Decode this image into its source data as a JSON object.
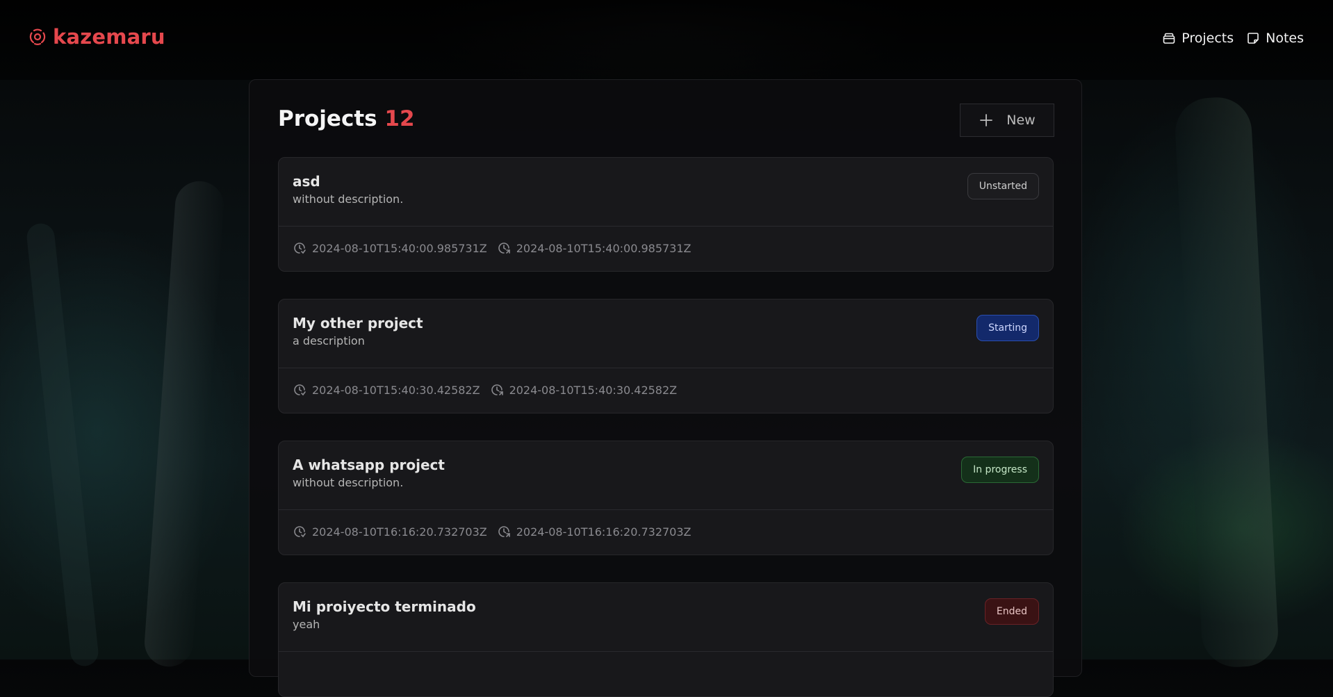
{
  "header": {
    "brand": "kazemaru",
    "nav": [
      {
        "label": "Projects",
        "icon": "archive-icon"
      },
      {
        "label": "Notes",
        "icon": "sticky-note-icon"
      }
    ]
  },
  "panel": {
    "title": "Projects",
    "count": "12",
    "new_button_label": "New"
  },
  "projects": [
    {
      "name": "asd",
      "description": "without description.",
      "status": "Unstarted",
      "created_at": "2024-08-10T15:40:00.985731Z",
      "updated_at": "2024-08-10T15:40:00.985731Z"
    },
    {
      "name": "My other project",
      "description": "a description",
      "status": "Starting",
      "created_at": "2024-08-10T15:40:30.42582Z",
      "updated_at": "2024-08-10T15:40:30.42582Z"
    },
    {
      "name": "A whatsapp project",
      "description": "without description.",
      "status": "In progress",
      "created_at": "2024-08-10T16:16:20.732703Z",
      "updated_at": "2024-08-10T16:16:20.732703Z"
    },
    {
      "name": "Mi proiyecto terminado",
      "description": "yeah",
      "status": "Ended"
    }
  ],
  "colors": {
    "accent": "#e5484d",
    "unstarted": "#3a3a3e",
    "starting": "#13296b",
    "in_progress": "#14301a",
    "ended": "#3a1214"
  }
}
